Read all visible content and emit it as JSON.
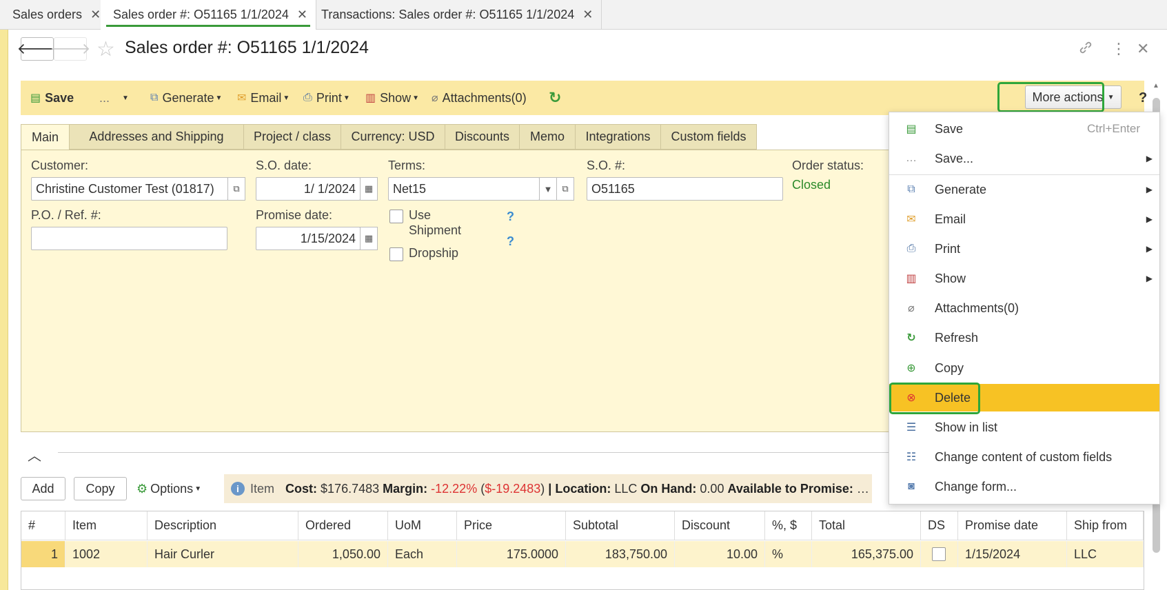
{
  "tabs": [
    {
      "label": "Sales orders"
    },
    {
      "label": "Sales order #: O51165 1/1/2024"
    },
    {
      "label": "Transactions: Sales order #: O51165 1/1/2024"
    }
  ],
  "header": {
    "title": "Sales order #: O51165 1/1/2024"
  },
  "toolbar": {
    "save": "Save",
    "ellipsis": "...",
    "generate": "Generate",
    "email": "Email",
    "print": "Print",
    "show": "Show",
    "attachments": "Attachments(0)",
    "more_actions": "More actions",
    "help": "?"
  },
  "form_tabs": [
    "Main",
    "Addresses and Shipping",
    "Project / class",
    "Currency: USD",
    "Discounts",
    "Memo",
    "Integrations",
    "Custom fields"
  ],
  "form": {
    "customer_label": "Customer:",
    "customer_value": "Christine Customer Test (01817)",
    "so_date_label": "S.O. date:",
    "so_date_value": "1/ 1/2024",
    "terms_label": "Terms:",
    "terms_value": "Net15",
    "so_num_label": "S.O. #:",
    "so_num_value": "O51165",
    "order_status_label": "Order status:",
    "order_status_value": "Closed",
    "po_label": "P.O. / Ref. #:",
    "po_value": "",
    "promise_label": "Promise date:",
    "promise_value": "1/15/2024",
    "use_shipment_1": "Use",
    "use_shipment_2": "Shipment",
    "dropship": "Dropship",
    "q": "?"
  },
  "table_toolbar": {
    "add": "Add",
    "copy": "Copy",
    "options": "Options",
    "item": "Item",
    "cost_label": "Cost:",
    "cost_value": "$176.7483",
    "margin_label": "Margin:",
    "margin_value": "-12.22%",
    "margin_amount": "$-19.2483",
    "location_label": "Location:",
    "location_value": "LLC",
    "on_hand_label": "On Hand:",
    "on_hand_value": "0.00",
    "atp_label": "Available to Promise:"
  },
  "grid": {
    "headers": [
      "#",
      "Item",
      "Description",
      "Ordered",
      "UoM",
      "Price",
      "Subtotal",
      "Discount",
      "%, $",
      "Total",
      "DS",
      "Promise date",
      "Ship from"
    ],
    "rows": [
      [
        "1",
        "1002",
        "Hair Curler",
        "1,050.00",
        "Each",
        "175.0000",
        "183,750.00",
        "10.00",
        "%",
        "165,375.00",
        "",
        "1/15/2024",
        "LLC"
      ]
    ]
  },
  "menu": {
    "items": [
      {
        "label": "Save",
        "shortcut": "Ctrl+Enter",
        "icon": "save-icon"
      },
      {
        "label": "Save...",
        "icon": "ellipsis-icon"
      },
      {
        "label": "Generate",
        "icon": "generate-icon"
      },
      {
        "label": "Email",
        "icon": "envelope-icon"
      },
      {
        "label": "Print",
        "icon": "printer-icon"
      },
      {
        "label": "Show",
        "icon": "report-icon"
      },
      {
        "label": "Attachments(0)",
        "icon": "paperclip-icon"
      },
      {
        "label": "Refresh",
        "icon": "refresh-icon"
      },
      {
        "label": "Copy",
        "icon": "copy-icon"
      },
      {
        "label": "Delete",
        "icon": "delete-icon"
      },
      {
        "label": "Show in list",
        "icon": "list-icon"
      },
      {
        "label": "Change content of custom fields",
        "icon": "custom-fields-icon"
      },
      {
        "label": "Change form...",
        "icon": "form-icon"
      }
    ]
  },
  "colors": {
    "toolbar_bg": "#fbe9a4",
    "form_bg": "#fff8d6",
    "highlight_green": "#2ea63a",
    "menu_active": "#f7c224",
    "status_green": "#2a8a2a",
    "margin_red": "#d33"
  }
}
